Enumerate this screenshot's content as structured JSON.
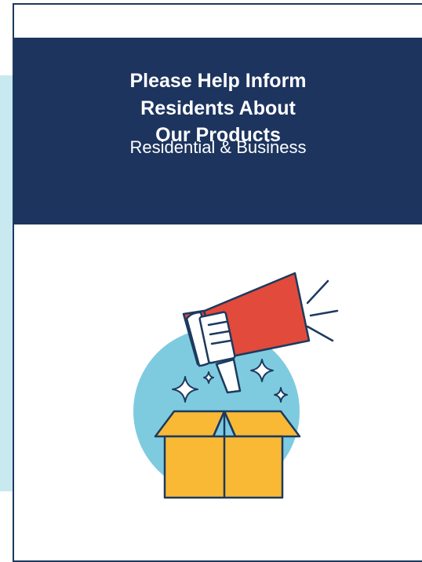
{
  "banner": {
    "title": "Please Help Inform\n Residents About\nOur Products",
    "subtitle": "Residential & Business"
  },
  "colors": {
    "banner_bg": "#1c345e",
    "frame_border": "#1c3a5f",
    "side_strip": "#c9e9f1",
    "circle": "#7ecbe0",
    "megaphone_red": "#e24a3b",
    "box_yellow": "#f9b935",
    "outline": "#1c3a5f"
  },
  "illustration": {
    "icons": [
      "megaphone-icon",
      "open-box-icon",
      "sparkle-icon"
    ]
  }
}
